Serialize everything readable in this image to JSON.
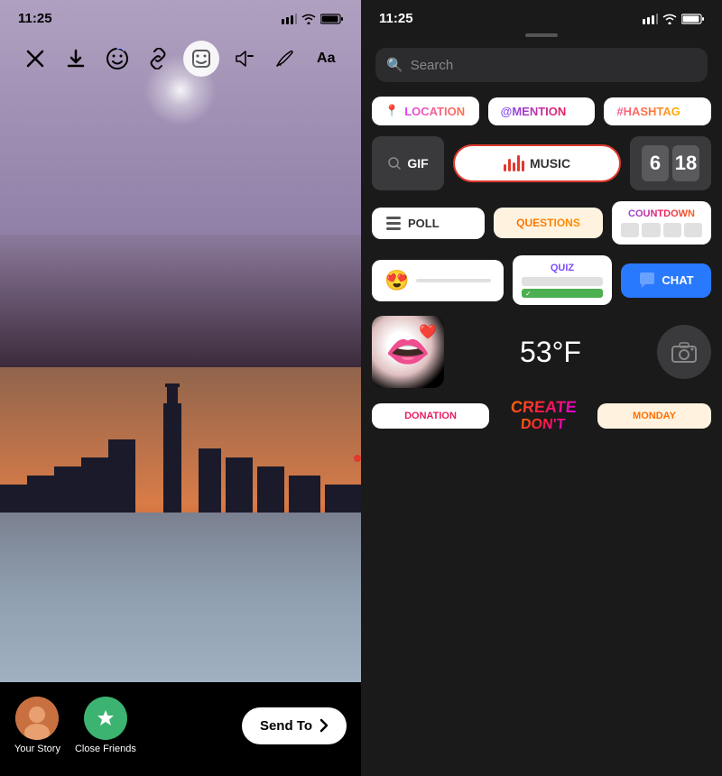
{
  "left": {
    "status_time": "11:25",
    "toolbar": {
      "close": "✕",
      "download": "⬇",
      "emoji": "☺",
      "link": "🔗",
      "sticker": "◻",
      "volume": "🔇",
      "draw": "✏",
      "text": "Aa"
    },
    "bottom": {
      "your_story_label": "Your Story",
      "close_friends_label": "Close Friends",
      "send_to_label": "Send To",
      "send_to_arrow": "›"
    }
  },
  "right": {
    "status_time": "11:25",
    "search_placeholder": "Search",
    "stickers": {
      "row1": [
        {
          "id": "location",
          "label": "LOCATION",
          "icon": "📍"
        },
        {
          "id": "mention",
          "label": "@MENTION"
        },
        {
          "id": "hashtag",
          "label": "#HASHTAG"
        }
      ],
      "row2": {
        "gif_label": "GIF",
        "music_label": "MUSIC",
        "clock_d1": "6",
        "clock_d2": "18"
      },
      "row3": {
        "poll_label": "POLL",
        "questions_label": "QUESTIONS",
        "countdown_label": "COUNTDOWN",
        "countdown_blocks": 4
      },
      "row4": {
        "quiz_label": "QUIZ",
        "chat_label": "CHAT"
      },
      "row5": {
        "temp_label": "53°F"
      },
      "bottom": {
        "donation_label": "DONATION",
        "create_label": "CREATE",
        "dont_label": "DON'T",
        "monday_label": "MONDAY"
      }
    }
  }
}
